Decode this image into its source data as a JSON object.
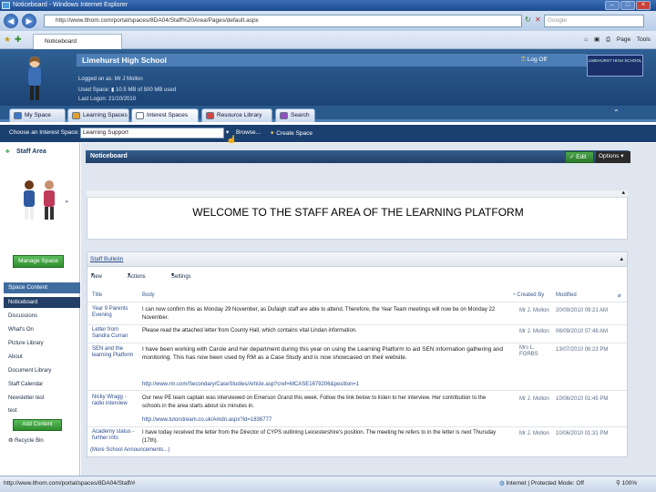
{
  "window": {
    "title": "Noticeboard - Windows Internet Explorer",
    "buttons": [
      "–",
      "□",
      "×"
    ]
  },
  "browser": {
    "url": "http://www.lthom.com/portal/spaces/8DA04/Staff%20Area/Pages/default.aspx",
    "search_placeholder": "Google",
    "tab_label": "Noticeboard",
    "tools": [
      "Page",
      "Tools"
    ]
  },
  "header": {
    "school_name": "Limehurst High School",
    "logged_in_as": "Logged on as:  Mr J Mollon",
    "used_space": "Used Space:  ▮ 10.5 MB of 500 MB used",
    "last_logon": "Last Logon:  21/10/2010",
    "exit_label": "Log Off",
    "logo_text": "LIMEHURST HIGH SCHOOL"
  },
  "portal_tabs": [
    {
      "label": "My Space",
      "color": "#3c78c8"
    },
    {
      "label": "Learning Spaces",
      "color": "#e0a030"
    },
    {
      "label": "Interest Spaces",
      "color": "#ffffff"
    },
    {
      "label": "Resource Library",
      "color": "#d04848"
    },
    {
      "label": "Search",
      "color": "#9050c0"
    }
  ],
  "space_bar": {
    "choose_label": "Choose an Interest Space:",
    "selected": "Learning Support",
    "browse": "Browse...",
    "create": "Create Space"
  },
  "sidebar": {
    "title": "Staff Area",
    "manage_button": "Manage Space",
    "content_title": "Space Content",
    "items": [
      "Noticeboard",
      "Discussions",
      "What's On",
      "Picture Library",
      "About",
      "Document Library",
      "Staff Calendar",
      "Newsletter test",
      "test"
    ],
    "add_button": "Add Content",
    "recycle": "Recycle Bin"
  },
  "main": {
    "header": "Noticeboard",
    "edit_button": "Edit",
    "options_button": "Options",
    "welcome": "WELCOME TO THE STAFF AREA OF THE LEARNING PLATFORM",
    "bulletin_title": "Staff Bulletin",
    "toolbar": [
      "New",
      "Actions",
      "Settings"
    ],
    "columns": [
      "Title",
      "Body",
      "Created By",
      "Modified"
    ],
    "rows": [
      {
        "title": "Year 9 Parents Evening",
        "body": "I can now confirm this as Monday 29 November, as Dufaigh staff are able to attend. Therefore, the Year Team meetings will now be on Monday 22 November.",
        "by": "Mr J. Mollon",
        "modified": "20/09/2010 09:21 AM"
      },
      {
        "title": "Letter from Sandra Curran",
        "body": "Please read the attached letter from County Hall, which contains vital Lindan information.",
        "by": "Mr J. Mollon",
        "modified": "06/09/2010 07:48 AM"
      },
      {
        "title": "SEN and the learning Platform",
        "body": "I have been working with Carole and her department during this year on using the Learning Platform to aid SEN information gathering and monitoring. This has now been used by RM as a Case Study and is now showcased on their website.",
        "link": "http://www.rm.com/Secondary/CaseStudies/Article.asp?cref=MCASE1679206&position=1",
        "by": "Mrs L. FORBS",
        "modified": "13/07/2010 06:23 PM"
      },
      {
        "title": "Nicky Wragg - radio interview",
        "body": "Our new PE team captain was interviewed on Emerson Grand this week. Follow the link below to listen to her interview. Her contribution to the schools in the area starts about six minutes in.",
        "link": "http://www.tutorstream.co.uk/Amdn.aspx?id=1836777",
        "by": "Mr J. Mollon",
        "modified": "10/06/2010 01:45 PM"
      },
      {
        "title": "Academy status - further info",
        "body": "I have today received the letter from the Director of CYPS outlining Leicestershire's position. The meeting he refers to in the letter is next Thursday (17th).",
        "by": "Mr J. Mollon",
        "modified": "10/06/2010 01:31 PM"
      }
    ],
    "more_link": "(More School Announcements...)"
  },
  "status": {
    "url": "http://www.lthom.com/portal/spaces/8DA04/Staff/#",
    "zone": "Internet | Protected Mode: Off",
    "zoom": "100%"
  }
}
